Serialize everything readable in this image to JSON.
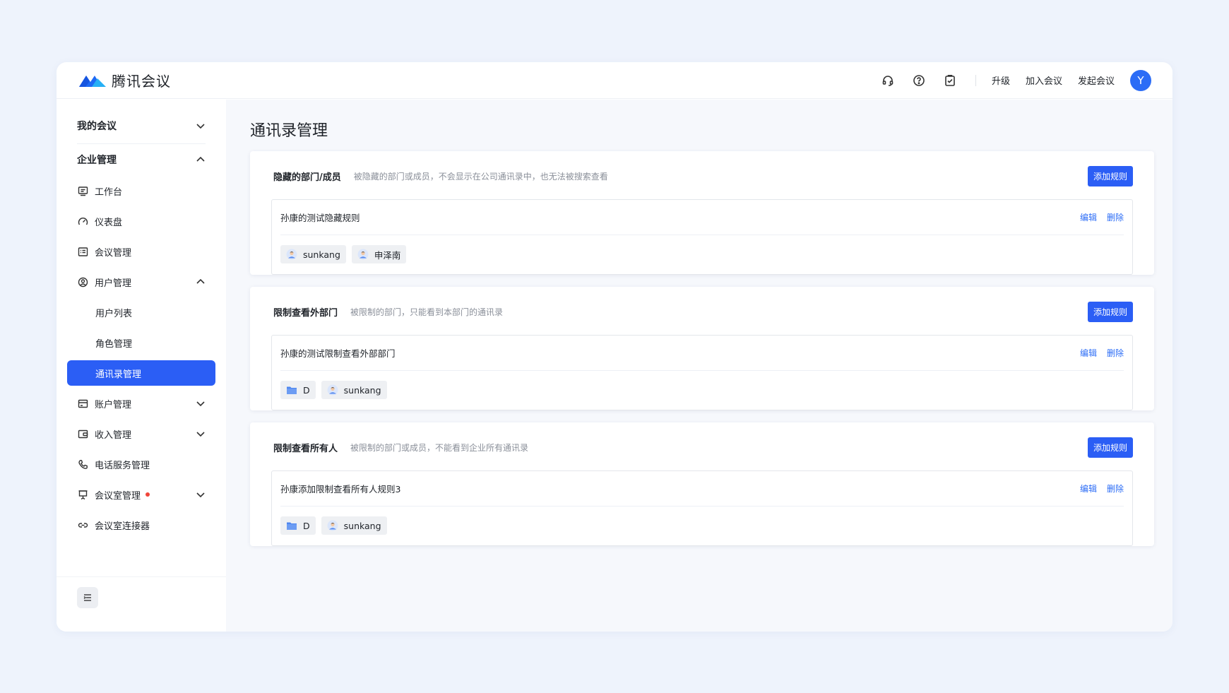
{
  "app": {
    "brand": "腾讯会议",
    "accent": "#2b5ef5"
  },
  "topbar": {
    "icons": [
      "headset-icon",
      "help-icon",
      "clipboard-check-icon"
    ],
    "links": [
      "升级",
      "加入会议",
      "发起会议"
    ],
    "avatar_letter": "Y"
  },
  "sidebar": {
    "groups": [
      {
        "label": "我的会议",
        "expanded": false
      },
      {
        "label": "企业管理",
        "expanded": true
      }
    ],
    "items": [
      {
        "label": "工作台",
        "icon": "monitor-icon"
      },
      {
        "label": "仪表盘",
        "icon": "gauge-icon"
      },
      {
        "label": "会议管理",
        "icon": "list-icon"
      },
      {
        "label": "用户管理",
        "icon": "user-circle-icon",
        "expanded": true
      },
      {
        "label": "用户列表"
      },
      {
        "label": "角色管理"
      },
      {
        "label": "通讯录管理",
        "active": true
      },
      {
        "label": "账户管理",
        "icon": "card-icon",
        "expanded": false
      },
      {
        "label": "收入管理",
        "icon": "wallet-icon",
        "expanded": false
      },
      {
        "label": "电话服务管理",
        "icon": "phone-icon"
      },
      {
        "label": "会议室管理",
        "icon": "projector-icon",
        "expanded": false,
        "badge": "red-dot"
      },
      {
        "label": "会议室连接器",
        "icon": "link-icon"
      }
    ]
  },
  "main": {
    "title": "通讯录管理",
    "sections": [
      {
        "title": "隐藏的部门/成员",
        "desc": "被隐藏的部门或成员，不会显示在公司通讯录中，也无法被搜索查看",
        "add_label": "添加规则",
        "rule": {
          "name": "孙康的测试隐藏规则",
          "edit": "编辑",
          "delete": "删除",
          "tags": [
            {
              "type": "user",
              "label": "sunkang"
            },
            {
              "type": "user",
              "label": "申泽南"
            }
          ]
        }
      },
      {
        "title": "限制查看外部门",
        "desc": "被限制的部门，只能看到本部门的通讯录",
        "add_label": "添加规则",
        "rule": {
          "name": "孙康的测试限制查看外部部门",
          "edit": "编辑",
          "delete": "删除",
          "tags": [
            {
              "type": "folder",
              "label": "D"
            },
            {
              "type": "user",
              "label": "sunkang"
            }
          ]
        }
      },
      {
        "title": "限制查看所有人",
        "desc": "被限制的部门或成员，不能看到企业所有通讯录",
        "add_label": "添加规则",
        "rule": {
          "name": "孙康添加限制查看所有人规则3",
          "edit": "编辑",
          "delete": "删除",
          "tags": [
            {
              "type": "folder",
              "label": "D"
            },
            {
              "type": "user",
              "label": "sunkang"
            }
          ]
        }
      }
    ]
  }
}
